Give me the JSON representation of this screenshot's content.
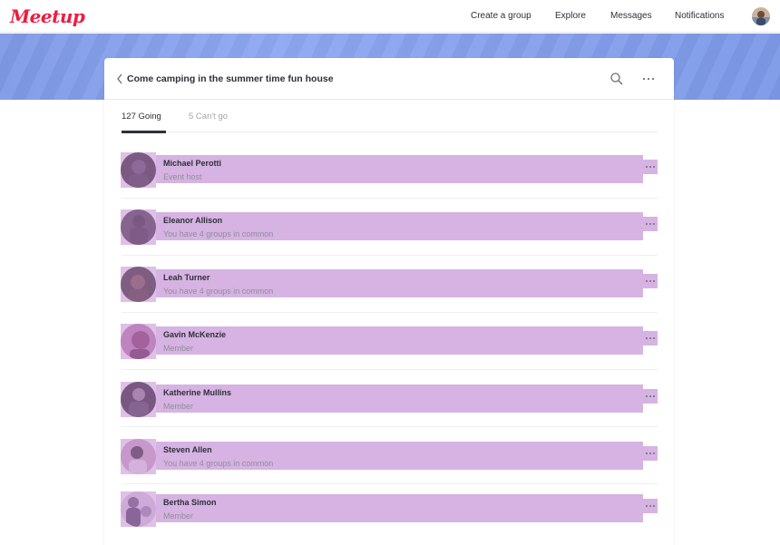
{
  "brand": {
    "logo_text": "Meetup",
    "color": "#ed1c40"
  },
  "nav": {
    "links": [
      "Create a group",
      "Explore",
      "Messages",
      "Notifications"
    ],
    "avatar_icon": "user-avatar"
  },
  "event": {
    "title": "Come camping in the summer time fun house",
    "back_icon": "chevron-left-icon",
    "search_icon": "search-icon",
    "more_icon": "more-horizontal-icon"
  },
  "tabs": {
    "going": "127 Going",
    "cant_go": "5 Can't go",
    "active": "going"
  },
  "members": [
    {
      "name": "Michael Perotti",
      "subtitle": "Event host"
    },
    {
      "name": "Eleanor Allison",
      "subtitle": "You have 4 groups in common"
    },
    {
      "name": "Leah Turner",
      "subtitle": "You have 4 groups in common"
    },
    {
      "name": "Gavin McKenzie",
      "subtitle": "Member"
    },
    {
      "name": "Katherine Mullins",
      "subtitle": "Member"
    },
    {
      "name": "Steven Allen",
      "subtitle": "You have 4 groups in common"
    },
    {
      "name": "Bertha Simon",
      "subtitle": "Member"
    }
  ],
  "colors": {
    "hero": "#8aa3ef",
    "highlight": "#d6b3e2",
    "text_dark": "#2e3039",
    "text_muted": "#8d8f99"
  }
}
